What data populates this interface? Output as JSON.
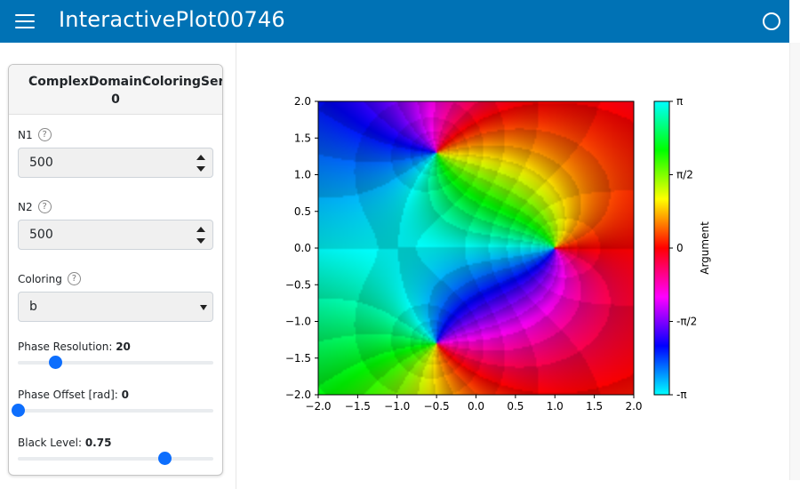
{
  "header": {
    "title": "InteractivePlot00746"
  },
  "panel": {
    "title_line1": "ComplexDomainColoringSerie",
    "title_line2": "0",
    "n1": {
      "label": "N1",
      "help": "?",
      "value": "500"
    },
    "n2": {
      "label": "N2",
      "help": "?",
      "value": "500"
    },
    "coloring": {
      "label": "Coloring",
      "help": "?",
      "value": "b"
    },
    "phase_resolution": {
      "label": "Phase Resolution: ",
      "value": "20",
      "fraction": 0.19
    },
    "phase_offset": {
      "label": "Phase Offset [rad]: ",
      "value": "0",
      "fraction": 0.0
    },
    "black_level": {
      "label": "Black Level: ",
      "value": "0.75",
      "fraction": 0.75
    }
  },
  "colors": {
    "accent": "#0072b5",
    "slider": "#0d6efd"
  },
  "chart_data": {
    "type": "heatmap",
    "title": "",
    "xlabel": "",
    "ylabel": "",
    "xlim": [
      -2.0,
      2.0
    ],
    "ylim": [
      -2.0,
      2.0
    ],
    "x_ticks": [
      "−2.0",
      "−1.5",
      "−1.0",
      "−0.5",
      "0.0",
      "0.5",
      "1.0",
      "1.5",
      "2.0"
    ],
    "y_ticks": [
      "2.0",
      "1.5",
      "1.0",
      "0.5",
      "0.0",
      "−0.5",
      "−1.0",
      "−1.5",
      "−2.0"
    ],
    "colorbar": {
      "label": "Argument",
      "ticks": [
        "π",
        "π/2",
        "0",
        "-π/2",
        "-π"
      ]
    },
    "points": [
      {
        "kind": "zero",
        "x": 1.0,
        "y": 0.0
      },
      {
        "kind": "pole",
        "x": -0.5,
        "y": 1.3
      },
      {
        "kind": "pole",
        "x": -0.5,
        "y": -1.3
      }
    ]
  }
}
